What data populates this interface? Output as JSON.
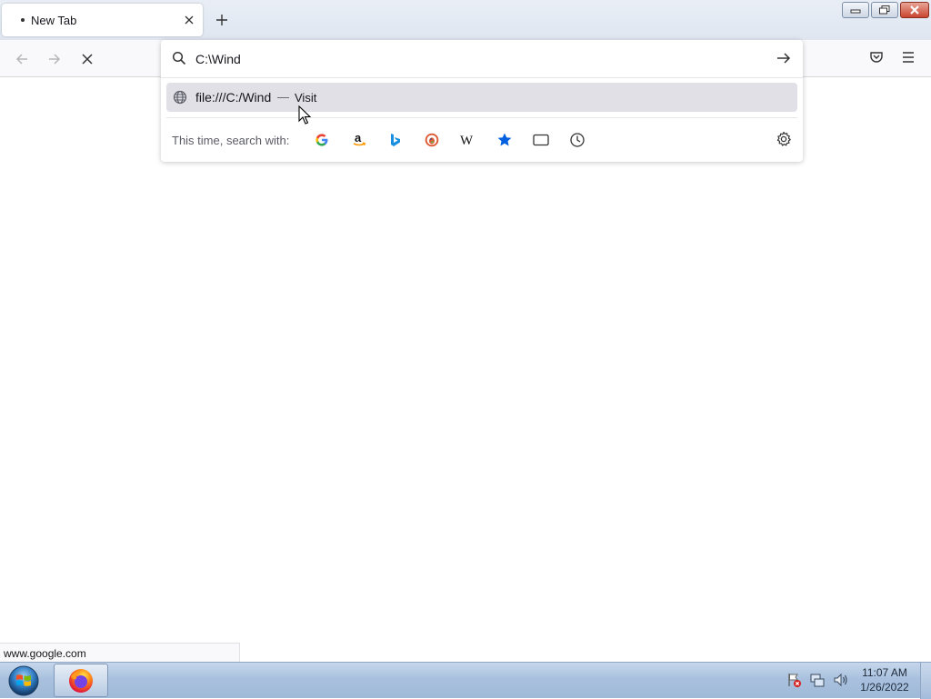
{
  "tab": {
    "title": "New Tab"
  },
  "urlbar": {
    "value": "C:\\Wind",
    "result_url": "file:///C:/Wind",
    "result_separator": "—",
    "result_action": "Visit",
    "search_with_label": "This time, search with:"
  },
  "search_engines": [
    "google-icon",
    "amazon-icon",
    "bing-icon",
    "duckduckgo-icon",
    "wikipedia-icon",
    "bookmarks-icon",
    "tabs-icon",
    "history-icon"
  ],
  "status": {
    "link": "www.google.com"
  },
  "taskbar": {
    "time": "11:07 AM",
    "date": "1/26/2022"
  },
  "colors": {
    "accent": "#0060df",
    "selected_row": "#e0e0e6"
  }
}
